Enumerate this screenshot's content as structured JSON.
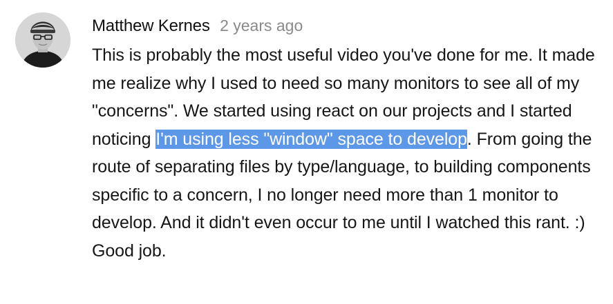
{
  "comment": {
    "avatar_icon": "user-avatar-photo",
    "author": "Matthew Kernes",
    "timestamp": "2 years ago",
    "text_before_selection": "This is probably the most useful video you've done for me. It made me realize why I used to need so many monitors to see all of my \"concerns\". We started using react on our projects and I started noticing ",
    "selected_text": "I'm using less \"window\" space to develop",
    "text_after_selection": ". From going the route of separating files by type/language, to building components specific to a concern, I no longer need more than 1 monitor to develop. And it didn't even occur to me until I watched this rant. :) Good job."
  },
  "colors": {
    "selection_highlight": "#5c97e8",
    "author_text": "#111111",
    "timestamp_text": "#8a8a8a",
    "body_text": "#161616"
  }
}
